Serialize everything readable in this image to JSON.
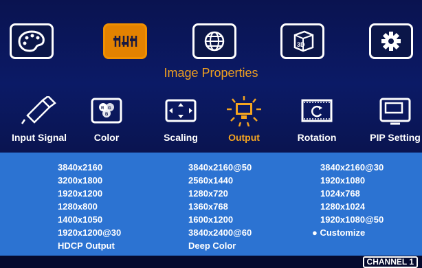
{
  "top_icons": [
    {
      "name": "palette-icon",
      "selected": false
    },
    {
      "name": "image-adjust-icon",
      "selected": true
    },
    {
      "name": "globe-icon",
      "selected": false
    },
    {
      "name": "3d-cube-icon",
      "selected": false
    },
    {
      "name": "gear-icon",
      "selected": false
    }
  ],
  "section_title": "Image Properties",
  "submenu": [
    {
      "label": "Input Signal",
      "icon": "usb-plug-icon",
      "selected": false
    },
    {
      "label": "Color",
      "icon": "color-circles-icon",
      "selected": false
    },
    {
      "label": "Scaling",
      "icon": "scaling-arrows-icon",
      "selected": false
    },
    {
      "label": "Output",
      "icon": "monitor-glow-icon",
      "selected": true
    },
    {
      "label": "Rotation",
      "icon": "rotation-icon",
      "selected": false
    },
    {
      "label": "PIP Setting",
      "icon": "pip-window-icon",
      "selected": false
    }
  ],
  "resolutions": {
    "col1": [
      "3840x2160",
      "3200x1800",
      "1920x1200",
      "1280x800",
      "1400x1050",
      "1920x1200@30",
      "HDCP Output"
    ],
    "col2": [
      "3840x2160@50",
      "2560x1440",
      "1280x720",
      "1360x768",
      "1600x1200",
      "3840x2400@60",
      "Deep Color"
    ],
    "col3": [
      "3840x2160@30",
      "1920x1080",
      "1024x768",
      "1280x1024",
      "1920x1080@50",
      "● Customize"
    ]
  },
  "channel": "CHANNEL 1",
  "colors": {
    "accent": "#f5a520",
    "panel": "#2c73d2",
    "header": "#0b1a66"
  }
}
